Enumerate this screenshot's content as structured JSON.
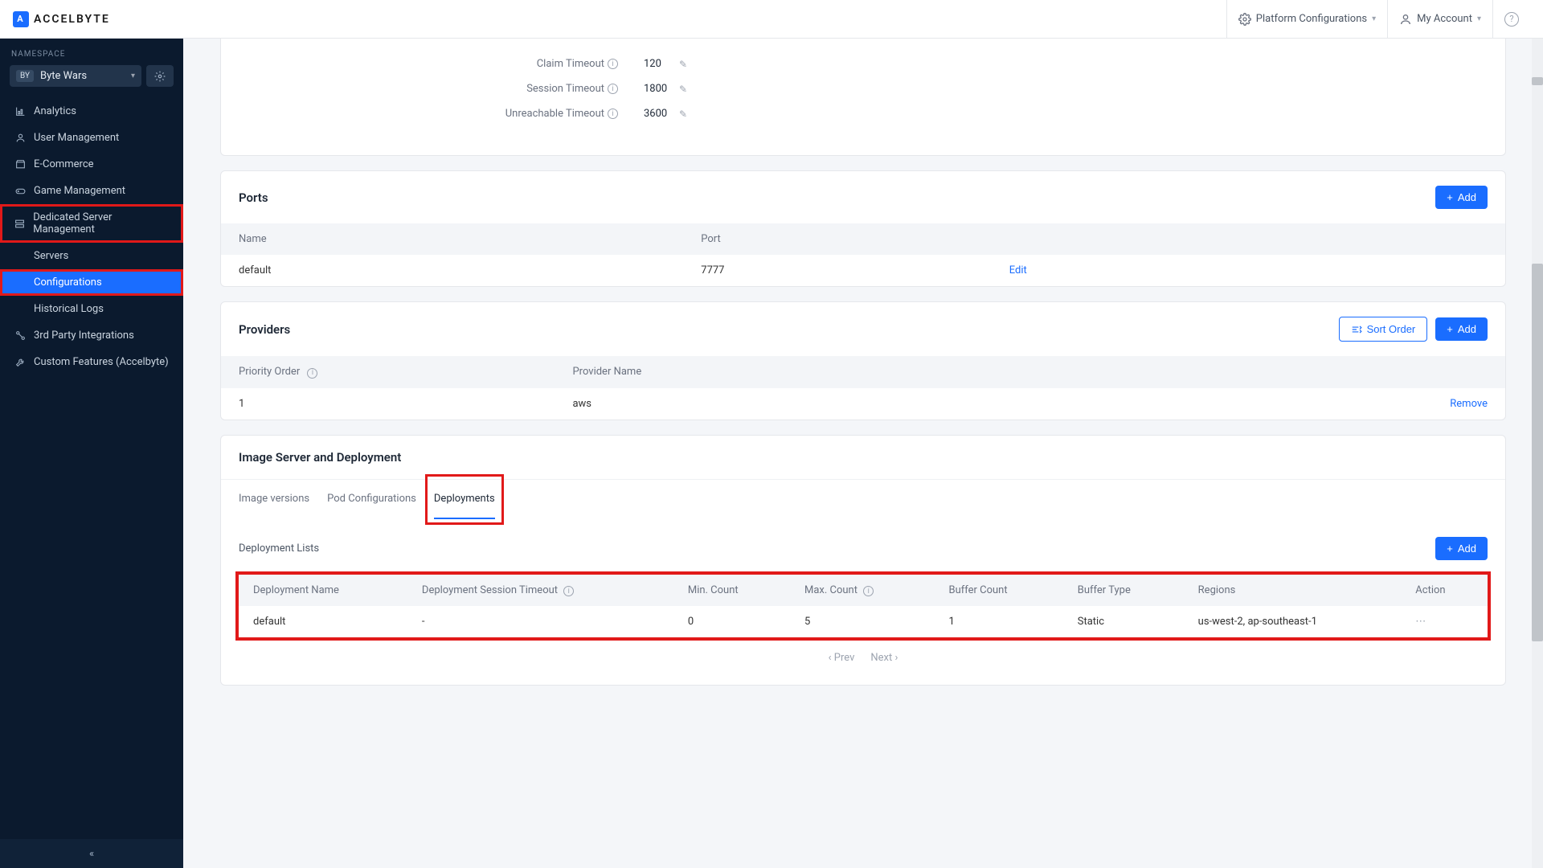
{
  "header": {
    "brand": "ACCELBYTE",
    "platform_config": "Platform Configurations",
    "my_account": "My Account"
  },
  "sidebar": {
    "namespace_label": "NAMESPACE",
    "namespace_badge": "BY",
    "namespace_name": "Byte Wars",
    "items": {
      "analytics": "Analytics",
      "user_mgmt": "User Management",
      "ecommerce": "E-Commerce",
      "game_mgmt": "Game Management",
      "dsm": "Dedicated Server Management",
      "servers": "Servers",
      "configurations": "Configurations",
      "historical": "Historical Logs",
      "third_party": "3rd Party Integrations",
      "custom": "Custom Features (Accelbyte)"
    }
  },
  "timeouts": {
    "claim_label": "Claim Timeout",
    "claim_value": "120",
    "session_label": "Session Timeout",
    "session_value": "1800",
    "unreach_label": "Unreachable Timeout",
    "unreach_value": "3600"
  },
  "ports": {
    "title": "Ports",
    "add_label": "Add",
    "col_name": "Name",
    "col_port": "Port",
    "row_name": "default",
    "row_port": "7777",
    "edit": "Edit"
  },
  "providers": {
    "title": "Providers",
    "sort_label": "Sort Order",
    "add_label": "Add",
    "col_priority": "Priority Order",
    "col_provider": "Provider Name",
    "row_priority": "1",
    "row_provider": "aws",
    "remove": "Remove"
  },
  "image_deploy": {
    "title": "Image Server and Deployment",
    "tab_image": "Image versions",
    "tab_pod": "Pod Configurations",
    "tab_deploy": "Deployments",
    "list_title": "Deployment Lists",
    "add_label": "Add",
    "cols": {
      "name": "Deployment Name",
      "session_timeout": "Deployment Session Timeout",
      "min": "Min. Count",
      "max": "Max. Count",
      "buffer_count": "Buffer Count",
      "buffer_type": "Buffer Type",
      "regions": "Regions",
      "action": "Action"
    },
    "row": {
      "name": "default",
      "session_timeout": "-",
      "min": "0",
      "max": "5",
      "buffer_count": "1",
      "buffer_type": "Static",
      "regions": "us-west-2, ap-southeast-1",
      "action": "⋯"
    },
    "prev": "Prev",
    "next": "Next"
  }
}
